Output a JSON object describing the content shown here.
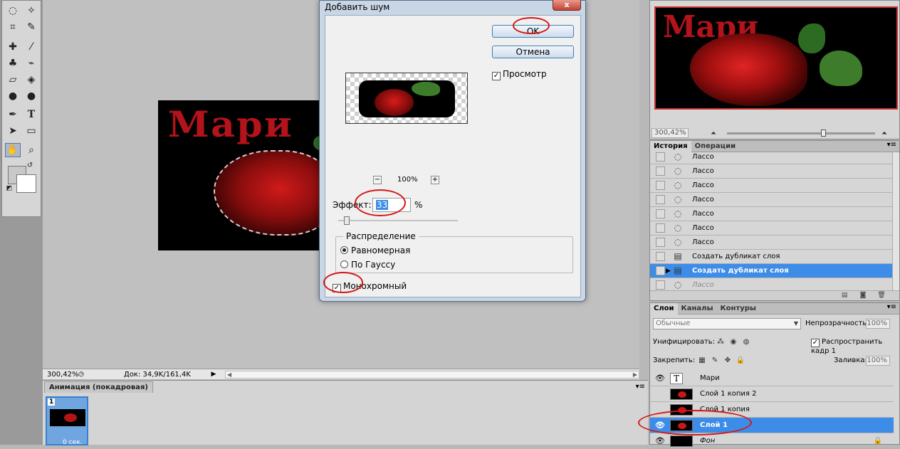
{
  "dialog": {
    "title": "Добавить шум",
    "close_label": "x",
    "ok_label": "OK",
    "cancel_label": "Отмена",
    "preview_label": "Просмотр",
    "preview_checked": true,
    "zoom_value": "100%",
    "zoom_minus": "−",
    "zoom_plus": "+",
    "effect_label": "Эффект:",
    "effect_value": "33",
    "effect_unit": "%",
    "distribution": {
      "title": "Распределение",
      "options": [
        "Равномерная",
        "По Гауссу"
      ],
      "selected": "Равномерная"
    },
    "mono_label": "Монохромный",
    "mono_checked": true
  },
  "canvas": {
    "image_title": "Мари"
  },
  "statusbar": {
    "zoom": "300,42%",
    "doc": "Док: 34,9K/161,4K"
  },
  "animation": {
    "tab_label": "Анимация (покадровая)",
    "frame_number": "1",
    "frame_time": "0 сек."
  },
  "navigator": {
    "image_title": "Мари",
    "zoom": "300,42%"
  },
  "history": {
    "tabs": [
      "История",
      "Операции"
    ],
    "active_tab": "История",
    "items": [
      {
        "label": "Лассо",
        "icon": "lasso-icon"
      },
      {
        "label": "Лассо",
        "icon": "lasso-icon"
      },
      {
        "label": "Лассо",
        "icon": "lasso-icon"
      },
      {
        "label": "Лассо",
        "icon": "lasso-icon"
      },
      {
        "label": "Лассо",
        "icon": "lasso-icon"
      },
      {
        "label": "Лассо",
        "icon": "lasso-icon"
      },
      {
        "label": "Лассо",
        "icon": "lasso-icon"
      },
      {
        "label": "Создать дубликат слоя",
        "icon": "document-icon"
      },
      {
        "label": "Создать дубликат слоя",
        "icon": "document-icon",
        "selected": true
      },
      {
        "label": "Лассо",
        "icon": "lasso-icon",
        "greyed": true
      }
    ]
  },
  "layers": {
    "tabs": [
      "Слои",
      "Каналы",
      "Контуры"
    ],
    "active_tab": "Слои",
    "blend_mode": "Обычные",
    "opacity_label": "Непрозрачность:",
    "opacity_value": "100%",
    "unify_label": "Унифицировать:",
    "propagate_label": "Распространить кадр 1",
    "lock_label": "Закрепить:",
    "fill_label": "Заливка:",
    "fill_value": "100%",
    "items": [
      {
        "name": "Мари",
        "type": "text",
        "visible": true
      },
      {
        "name": "Слой 1 копия 2",
        "type": "image",
        "visible": false
      },
      {
        "name": "Слой 1 копия",
        "type": "image",
        "visible": false
      },
      {
        "name": "Слой 1",
        "type": "image",
        "visible": true,
        "selected": true
      },
      {
        "name": "Фон",
        "type": "background",
        "visible": true,
        "locked": true
      }
    ]
  },
  "colors": {
    "selection_blue": "#3d8ce8",
    "annotation_red": "#d41616",
    "title_red": "#b3131b"
  }
}
